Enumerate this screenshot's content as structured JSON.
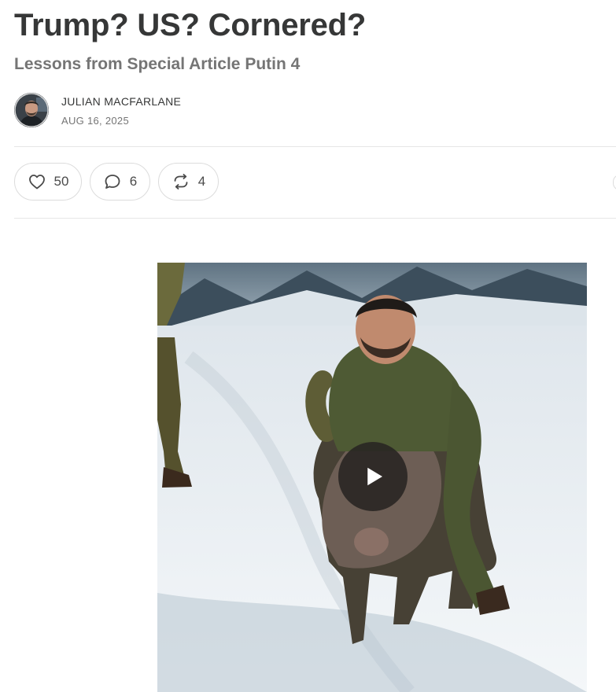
{
  "post": {
    "title": "Trump? US? Cornered?",
    "subtitle": "Lessons from Special Article Putin 4",
    "author": "JULIAN MACFARLANE",
    "date": "AUG 16, 2025"
  },
  "actions": {
    "likes": {
      "icon": "heart-icon",
      "count": "50"
    },
    "comments": {
      "icon": "comment-bubble-icon",
      "count": "6"
    },
    "restacks": {
      "icon": "restack-icon",
      "count": "4"
    }
  },
  "media": {
    "type": "video",
    "control_icon": "play-icon"
  },
  "colors": {
    "text": "#363737",
    "muted": "#757575",
    "border": "#dcdcdc",
    "divider": "#e6e6e6",
    "play_bg": "#282422"
  }
}
